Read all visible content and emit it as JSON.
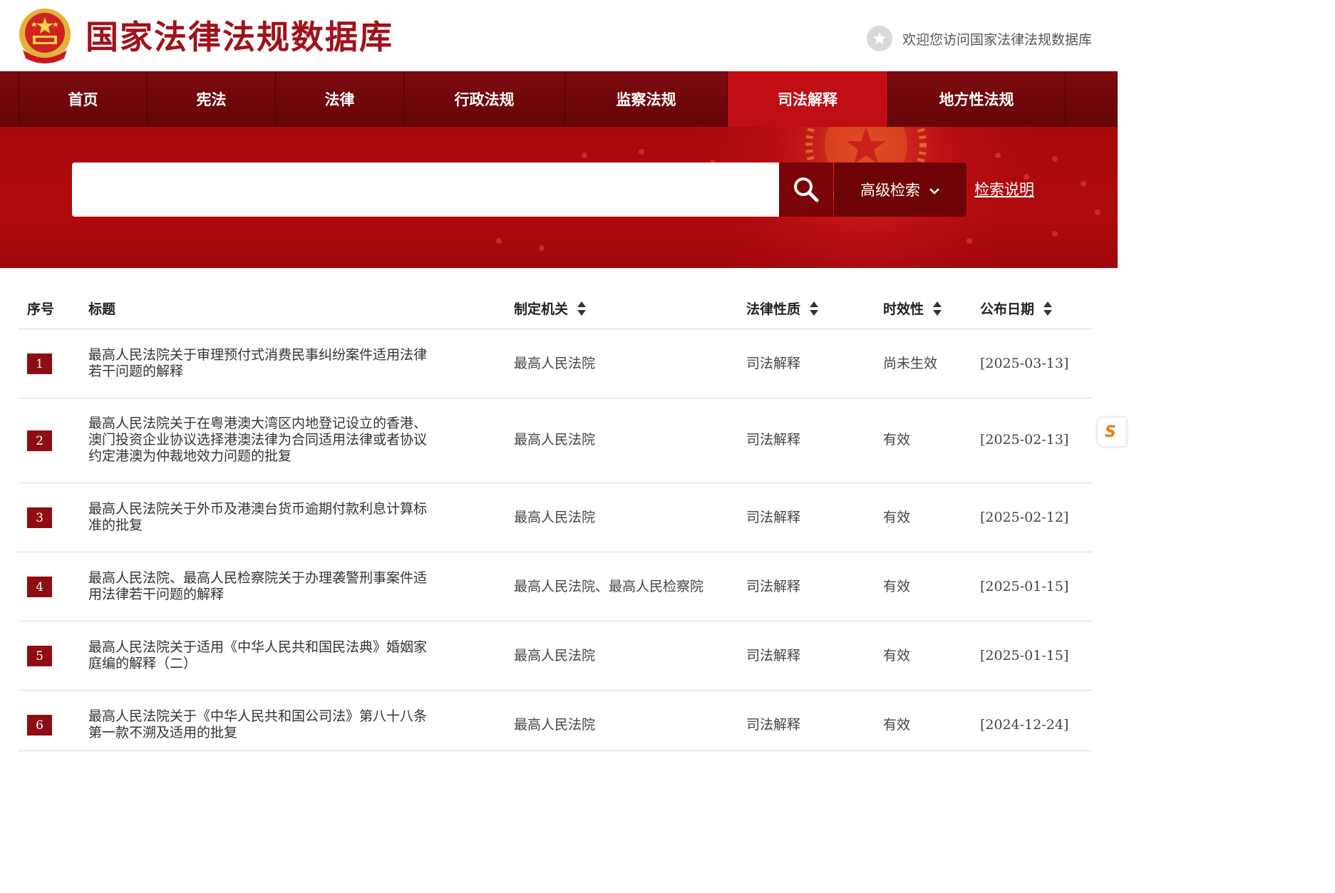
{
  "header": {
    "site_title": "国家法律法规数据库",
    "welcome": "欢迎您访问国家法律法规数据库"
  },
  "nav": {
    "items": [
      {
        "label": "首页"
      },
      {
        "label": "宪法"
      },
      {
        "label": "法律"
      },
      {
        "label": "行政法规"
      },
      {
        "label": "监察法规"
      },
      {
        "label": "司法解释"
      },
      {
        "label": "地方性法规"
      }
    ],
    "active": "司法解释"
  },
  "search": {
    "placeholder": "",
    "advanced_label": "高级检索",
    "help_label": "检索说明"
  },
  "table": {
    "headers": {
      "index": "序号",
      "title": "标题",
      "org": "制定机关",
      "nature": "法律性质",
      "validity": "时效性",
      "date": "公布日期"
    },
    "rows": [
      {
        "index": "1",
        "title_lines": [
          "最高人民法院关于审理预付式消费民事纠纷案件适用法律",
          "若干问题的解释"
        ],
        "org": "最高人民法院",
        "nature": "司法解释",
        "validity": "尚未生效",
        "date": "[2025-03-13]"
      },
      {
        "index": "2",
        "title_lines": [
          "最高人民法院关于在粤港澳大湾区内地登记设立的香港、",
          "澳门投资企业协议选择港澳法律为合同适用法律或者协议",
          "约定港澳为仲裁地效力问题的批复"
        ],
        "org": "最高人民法院",
        "nature": "司法解释",
        "validity": "有效",
        "date": "[2025-02-13]"
      },
      {
        "index": "3",
        "title_lines": [
          "最高人民法院关于外币及港澳台货币逾期付款利息计算标",
          "准的批复"
        ],
        "org": "最高人民法院",
        "nature": "司法解释",
        "validity": "有效",
        "date": "[2025-02-12]"
      },
      {
        "index": "4",
        "title_lines": [
          "最高人民法院、最高人民检察院关于办理袭警刑事案件适",
          "用法律若干问题的解释"
        ],
        "org": "最高人民法院、最高人民检察院",
        "nature": "司法解释",
        "validity": "有效",
        "date": "[2025-01-15]"
      },
      {
        "index": "5",
        "title_lines": [
          "最高人民法院关于适用《中华人民共和国民法典》婚姻家",
          "庭编的解释（二）"
        ],
        "org": "最高人民法院",
        "nature": "司法解释",
        "validity": "有效",
        "date": "[2025-01-15]"
      },
      {
        "index": "6",
        "title_lines": [
          "最高人民法院关于《中华人民共和国公司法》第八十八条",
          "第一款不溯及适用的批复"
        ],
        "org": "最高人民法院",
        "nature": "司法解释",
        "validity": "有效",
        "date": "[2024-12-24]"
      }
    ]
  },
  "side_widget": {
    "label": "S"
  },
  "colors": {
    "brand_red": "#a1111a",
    "nav_dark": "#6e0408",
    "nav_active": "#c10d14",
    "index_badge": "#8e0d12"
  }
}
